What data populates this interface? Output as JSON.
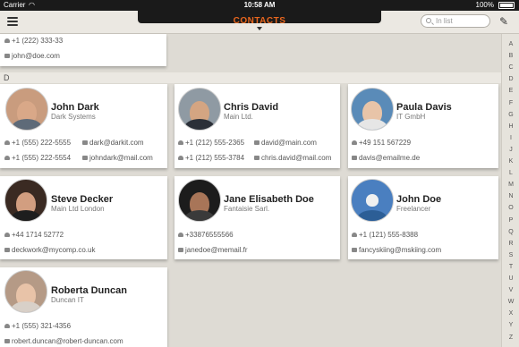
{
  "status": {
    "carrier": "Carrier",
    "time": "10:58 AM",
    "battery": "100%"
  },
  "nav": {
    "title": "CONTACTS",
    "search_placeholder": "In list"
  },
  "section": "D",
  "partial_card": {
    "phone": "+1 (222) 333-33",
    "email": "john@doe.com"
  },
  "contacts": [
    {
      "name": "John Dark",
      "company": "Dark Systems",
      "phones": [
        "+1 (555) 222-5555",
        "+1 (555) 222-5554"
      ],
      "emails": [
        "dark@darkit.com",
        "johndark@mail.com"
      ]
    },
    {
      "name": "Chris David",
      "company": "Main Ltd.",
      "phones": [
        "+1 (212) 555-2365",
        "+1 (212) 555-3784"
      ],
      "emails": [
        "david@main.com",
        "chris.david@mail.com"
      ]
    },
    {
      "name": "Paula Davis",
      "company": "IT GmbH",
      "phones": [
        "+49 151 567229"
      ],
      "emails": [
        "davis@emailme.de"
      ]
    },
    {
      "name": "Steve Decker",
      "company": "Main Ltd London",
      "phones": [
        "+44 1714 52772"
      ],
      "emails": [
        "deckwork@mycomp.co.uk"
      ]
    },
    {
      "name": "Jane Elisabeth Doe",
      "company": "Fantaisie Sarl.",
      "phones": [
        "+33876555566"
      ],
      "emails": [
        "janedoe@memail.fr"
      ]
    },
    {
      "name": "John Doe",
      "company": "Freelancer",
      "phones": [
        "+1 (121) 555-8388"
      ],
      "emails": [
        "fancyskiing@mskiing.com"
      ]
    },
    {
      "name": "Roberta Duncan",
      "company": "Duncan IT",
      "phones": [
        "+1 (555) 321-4356"
      ],
      "emails": [
        "robert.duncan@robert-duncan.com"
      ]
    }
  ],
  "index_letters": [
    "A",
    "B",
    "C",
    "D",
    "E",
    "F",
    "G",
    "H",
    "I",
    "J",
    "K",
    "L",
    "M",
    "N",
    "O",
    "P",
    "Q",
    "R",
    "S",
    "T",
    "U",
    "V",
    "W",
    "X",
    "Y",
    "Z"
  ]
}
